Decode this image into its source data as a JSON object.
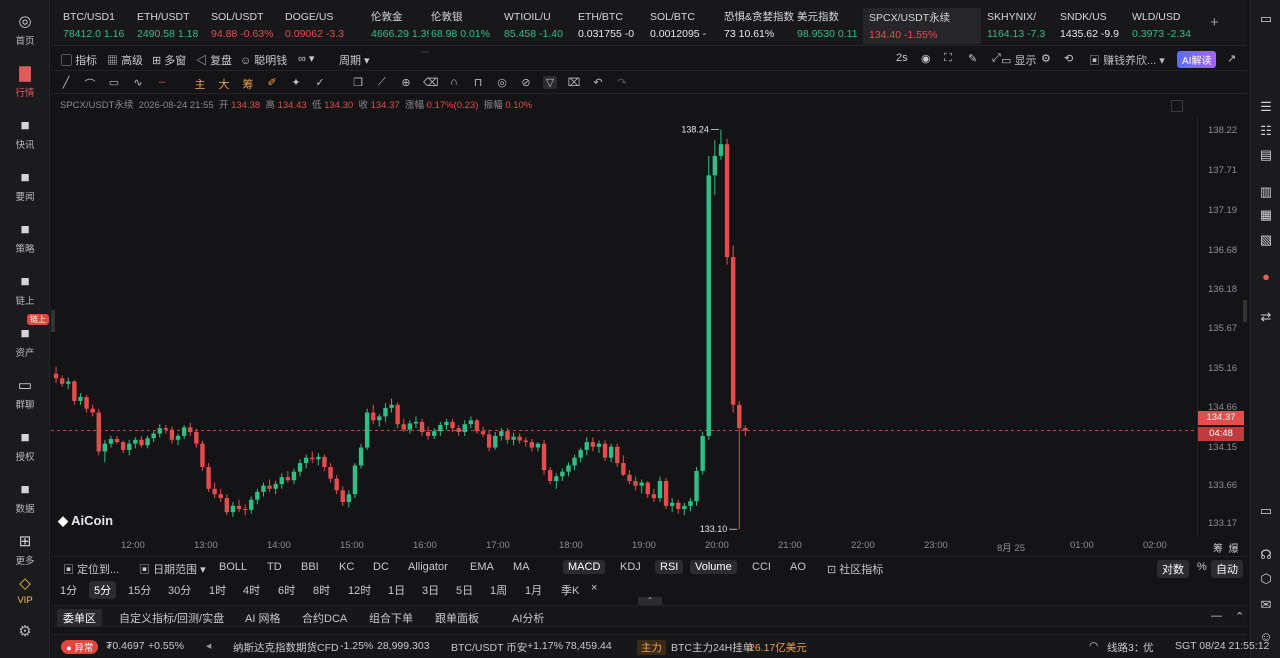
{
  "nav": {
    "items": [
      {
        "label": "首页",
        "icon": "home-icon"
      },
      {
        "label": "行情",
        "icon": "chart-icon"
      },
      {
        "label": "快讯",
        "icon": "news-icon"
      },
      {
        "label": "要闻",
        "icon": "document-icon"
      },
      {
        "label": "策略",
        "icon": "robot-icon"
      },
      {
        "label": "链上",
        "icon": "chain-icon"
      },
      {
        "label": "资产",
        "icon": "wallet-icon"
      },
      {
        "label": "群聊",
        "icon": "chat-icon"
      },
      {
        "label": "授权",
        "icon": "key-icon"
      },
      {
        "label": "数据",
        "icon": "data-icon"
      },
      {
        "label": "更多",
        "icon": "grid-icon"
      },
      {
        "label": "VIP",
        "icon": "diamond-icon"
      }
    ],
    "badge": "链上",
    "settings_icon": "gear-icon"
  },
  "ticker": [
    {
      "name": "BTC/USD1",
      "price": "78412.0",
      "change": "1.16",
      "dir": "up",
      "color": "#f5a623"
    },
    {
      "name": "ETH/USDT",
      "price": "2490.58",
      "change": "1.18",
      "dir": "up",
      "color": "#8a8fa8"
    },
    {
      "name": "SOL/USDT",
      "price": "94.88",
      "change": "-0.63%",
      "dir": "dn",
      "color": "#9d6bff"
    },
    {
      "name": "DOGE/US",
      "price": "0.09062",
      "change": "-3.3",
      "dir": "dn",
      "color": "#c9a94a"
    },
    {
      "name": "伦敦金",
      "price": "4666.29",
      "change": "1.39",
      "dir": "up",
      "color": ""
    },
    {
      "name": "伦敦银",
      "price": "68.98",
      "change": "0.01%",
      "dir": "up",
      "color": ""
    },
    {
      "name": "WTIOIL/U",
      "price": "85.458",
      "change": "-1.40",
      "dir": "up",
      "color": "#5a5a5e"
    },
    {
      "name": "ETH/BTC",
      "price": "0.031755",
      "change": "-0",
      "dir": "none",
      "color": "#8a8fa8"
    },
    {
      "name": "SOL/BTC",
      "price": "0.0012095",
      "change": "-",
      "dir": "none",
      "color": "#9d6bff"
    },
    {
      "name": "恐惧&贪婪指数",
      "price": "73",
      "change": "10.61%",
      "dir": "none",
      "color": ""
    },
    {
      "name": "美元指数",
      "price": "98.9530",
      "change": "0.11",
      "dir": "up",
      "color": ""
    },
    {
      "name": "SPCX/USDT永续",
      "price": "134.40",
      "change": "-1.55%",
      "dir": "dn",
      "color": "#f0c989"
    },
    {
      "name": "SKHYNIX/",
      "price": "1164.13",
      "change": "-7.3",
      "dir": "up",
      "color": "#5a5a5e"
    },
    {
      "name": "SNDK/US",
      "price": "1435.62",
      "change": "-9.9",
      "dir": "none",
      "color": "#5a5a5e"
    },
    {
      "name": "WLD/USD",
      "price": "0.3973",
      "change": "-2.34",
      "dir": "up",
      "color": "#7a7a7e"
    }
  ],
  "toolbar": {
    "indicators": "指标",
    "advanced": "高级",
    "multi": "多窗",
    "replay": "复盘",
    "smart": "聪明钱",
    "period": "周期",
    "intervals": [
      "1分",
      "5分",
      "15分",
      "30分",
      "1时",
      "4时",
      "6时",
      "8时",
      "12时",
      "1日",
      "3日",
      "5日",
      "1周",
      "1月"
    ],
    "selected_interval": "5分",
    "refresh": "2s",
    "display": "显示",
    "strategy": "赚钱养欣...",
    "ai": "AI解读"
  },
  "draw_tools": [
    "主",
    "大",
    "筹"
  ],
  "info": {
    "symbol": "SPCX/USDT永续",
    "datetime": "2026-08-24 21:55",
    "open_label": "开",
    "open": "134.38",
    "high_label": "高",
    "high": "134.43",
    "low_label": "低",
    "low": "134.30",
    "close_label": "收",
    "close": "134.37",
    "chg_label": "涨幅",
    "chg": "0.17%(0.23)",
    "amp_label": "振幅",
    "amp": "0.10%"
  },
  "chart_data": {
    "type": "candlestick",
    "symbol": "SPCX/USDT永续",
    "interval": "5分",
    "y_ticks": [
      138.22,
      137.71,
      137.19,
      136.68,
      136.18,
      135.67,
      135.16,
      134.66,
      134.15,
      133.66,
      133.17
    ],
    "ylim": [
      133.0,
      138.4
    ],
    "x_ticks": [
      "12:00",
      "13:00",
      "14:00",
      "15:00",
      "16:00",
      "17:00",
      "18:00",
      "19:00",
      "20:00",
      "21:00",
      "22:00",
      "23:00",
      "8月 25",
      "01:00",
      "02:00"
    ],
    "current_price": "134.37",
    "countdown": "04:48",
    "high_marker": "138.24",
    "low_marker": "133.10",
    "candles": [
      [
        135.1,
        135.19,
        134.98,
        135.04
      ],
      [
        135.04,
        135.08,
        134.93,
        134.97
      ],
      [
        134.97,
        135.05,
        134.9,
        135.0
      ],
      [
        135.0,
        135.02,
        134.7,
        134.75
      ],
      [
        134.75,
        134.85,
        134.7,
        134.8
      ],
      [
        134.8,
        134.83,
        134.6,
        134.65
      ],
      [
        134.65,
        134.7,
        134.55,
        134.6
      ],
      [
        134.6,
        134.65,
        134.05,
        134.1
      ],
      [
        134.1,
        134.25,
        133.96,
        134.2
      ],
      [
        134.2,
        134.3,
        134.15,
        134.26
      ],
      [
        134.26,
        134.3,
        134.2,
        134.22
      ],
      [
        134.22,
        134.24,
        134.08,
        134.12
      ],
      [
        134.12,
        134.25,
        134.05,
        134.2
      ],
      [
        134.2,
        134.28,
        134.14,
        134.25
      ],
      [
        134.25,
        134.3,
        134.15,
        134.18
      ],
      [
        134.18,
        134.3,
        134.14,
        134.27
      ],
      [
        134.27,
        134.36,
        134.22,
        134.33
      ],
      [
        134.33,
        134.45,
        134.28,
        134.4
      ],
      [
        134.4,
        134.44,
        134.33,
        134.38
      ],
      [
        134.38,
        134.42,
        134.2,
        134.25
      ],
      [
        134.25,
        134.33,
        134.18,
        134.3
      ],
      [
        134.3,
        134.44,
        134.26,
        134.41
      ],
      [
        134.41,
        134.47,
        134.3,
        134.35
      ],
      [
        134.35,
        134.39,
        134.15,
        134.2
      ],
      [
        134.2,
        134.24,
        133.85,
        133.9
      ],
      [
        133.9,
        133.95,
        133.58,
        133.62
      ],
      [
        133.62,
        133.7,
        133.5,
        133.55
      ],
      [
        133.55,
        133.62,
        133.45,
        133.5
      ],
      [
        133.5,
        133.55,
        133.28,
        133.32
      ],
      [
        133.32,
        133.45,
        133.26,
        133.4
      ],
      [
        133.4,
        133.48,
        133.32,
        133.36
      ],
      [
        133.36,
        133.42,
        133.28,
        133.35
      ],
      [
        133.35,
        133.52,
        133.3,
        133.48
      ],
      [
        133.48,
        133.62,
        133.42,
        133.58
      ],
      [
        133.58,
        133.7,
        133.52,
        133.66
      ],
      [
        133.66,
        133.74,
        133.58,
        133.62
      ],
      [
        133.62,
        133.72,
        133.55,
        133.68
      ],
      [
        133.68,
        133.82,
        133.62,
        133.77
      ],
      [
        133.77,
        133.85,
        133.7,
        133.73
      ],
      [
        133.73,
        133.88,
        133.68,
        133.84
      ],
      [
        133.84,
        134.0,
        133.78,
        133.95
      ],
      [
        133.95,
        134.06,
        133.88,
        134.02
      ],
      [
        134.02,
        134.1,
        133.95,
        134.0
      ],
      [
        134.0,
        134.08,
        133.92,
        134.03
      ],
      [
        134.03,
        134.06,
        133.85,
        133.9
      ],
      [
        133.9,
        133.95,
        133.7,
        133.75
      ],
      [
        133.75,
        133.8,
        133.55,
        133.6
      ],
      [
        133.6,
        133.65,
        133.4,
        133.45
      ],
      [
        133.45,
        133.6,
        133.38,
        133.55
      ],
      [
        133.55,
        133.95,
        133.5,
        133.92
      ],
      [
        133.92,
        134.2,
        133.88,
        134.15
      ],
      [
        134.15,
        134.65,
        134.12,
        134.6
      ],
      [
        134.6,
        134.7,
        134.45,
        134.5
      ],
      [
        134.5,
        134.58,
        134.42,
        134.55
      ],
      [
        134.55,
        134.72,
        134.48,
        134.66
      ],
      [
        134.66,
        134.78,
        134.6,
        134.7
      ],
      [
        134.7,
        134.73,
        134.4,
        134.45
      ],
      [
        134.45,
        134.52,
        134.35,
        134.38
      ],
      [
        134.38,
        134.5,
        134.33,
        134.46
      ],
      [
        134.46,
        134.55,
        134.4,
        134.48
      ],
      [
        134.48,
        134.52,
        134.3,
        134.35
      ],
      [
        134.35,
        134.42,
        134.25,
        134.3
      ],
      [
        134.3,
        134.4,
        134.26,
        134.36
      ],
      [
        134.36,
        134.48,
        134.3,
        134.44
      ],
      [
        134.44,
        134.52,
        134.38,
        134.48
      ],
      [
        134.48,
        134.52,
        134.35,
        134.4
      ],
      [
        134.4,
        134.44,
        134.3,
        134.35
      ],
      [
        134.35,
        134.5,
        134.3,
        134.45
      ],
      [
        134.45,
        134.55,
        134.4,
        134.5
      ],
      [
        134.5,
        134.52,
        134.33,
        134.36
      ],
      [
        134.36,
        134.42,
        134.28,
        134.32
      ],
      [
        134.32,
        134.38,
        134.1,
        134.15
      ],
      [
        134.15,
        134.35,
        134.12,
        134.3
      ],
      [
        134.3,
        134.4,
        134.24,
        134.36
      ],
      [
        134.36,
        134.4,
        134.2,
        134.25
      ],
      [
        134.25,
        134.34,
        134.18,
        134.29
      ],
      [
        134.29,
        134.33,
        134.2,
        134.24
      ],
      [
        134.24,
        134.28,
        134.16,
        134.22
      ],
      [
        134.22,
        134.26,
        134.1,
        134.15
      ],
      [
        134.15,
        134.22,
        134.1,
        134.2
      ],
      [
        134.2,
        134.25,
        133.8,
        133.86
      ],
      [
        133.86,
        133.9,
        133.68,
        133.72
      ],
      [
        133.72,
        133.82,
        133.62,
        133.78
      ],
      [
        133.78,
        133.88,
        133.72,
        133.84
      ],
      [
        133.84,
        133.96,
        133.78,
        133.92
      ],
      [
        133.92,
        134.06,
        133.86,
        134.02
      ],
      [
        134.02,
        134.15,
        133.96,
        134.12
      ],
      [
        134.12,
        134.28,
        134.05,
        134.22
      ],
      [
        134.22,
        134.28,
        134.1,
        134.16
      ],
      [
        134.16,
        134.24,
        134.08,
        134.2
      ],
      [
        134.2,
        134.24,
        133.98,
        134.02
      ],
      [
        134.02,
        134.2,
        133.96,
        134.16
      ],
      [
        134.16,
        134.2,
        133.9,
        133.95
      ],
      [
        133.95,
        134.05,
        133.78,
        133.8
      ],
      [
        133.8,
        133.86,
        133.68,
        133.72
      ],
      [
        133.72,
        133.78,
        133.6,
        133.66
      ],
      [
        133.66,
        133.74,
        133.56,
        133.7
      ],
      [
        133.7,
        133.72,
        133.5,
        133.55
      ],
      [
        133.55,
        133.62,
        133.45,
        133.5
      ],
      [
        133.5,
        133.78,
        133.45,
        133.72
      ],
      [
        133.72,
        133.76,
        133.36,
        133.4
      ],
      [
        133.4,
        133.5,
        133.32,
        133.44
      ],
      [
        133.44,
        133.48,
        133.3,
        133.36
      ],
      [
        133.36,
        133.44,
        133.28,
        133.4
      ],
      [
        133.4,
        133.5,
        133.33,
        133.46
      ],
      [
        133.46,
        133.9,
        133.4,
        133.85
      ],
      [
        133.85,
        134.35,
        133.8,
        134.3
      ],
      [
        134.3,
        137.9,
        134.25,
        137.65
      ],
      [
        137.65,
        138.1,
        137.4,
        137.9
      ],
      [
        137.9,
        138.24,
        137.85,
        138.05
      ],
      [
        138.05,
        138.12,
        136.5,
        136.6
      ],
      [
        136.6,
        136.75,
        134.6,
        134.7
      ],
      [
        134.7,
        134.75,
        133.1,
        134.4
      ],
      [
        134.4,
        134.43,
        134.3,
        134.37
      ]
    ]
  },
  "indicators": {
    "position": "定位到...",
    "daterange": "日期范围",
    "overlays": [
      "BOLL",
      "TD",
      "BBI",
      "KC",
      "DC",
      "Alligator",
      "EMA",
      "MA"
    ],
    "subs": [
      "MACD",
      "KDJ",
      "RSI",
      "Volume",
      "CCI",
      "AO"
    ],
    "subs_on": [
      "MACD",
      "RSI",
      "Volume"
    ],
    "community": "社区指标",
    "log": "对数",
    "pct": "%",
    "auto": "自动"
  },
  "periods": {
    "items": [
      "1分",
      "5分",
      "15分",
      "30分",
      "1时",
      "4时",
      "6时",
      "8时",
      "12时",
      "1日",
      "3日",
      "5日",
      "1周",
      "1月",
      "季K"
    ],
    "selected": "5分",
    "close": "×"
  },
  "tabs": {
    "items": [
      "委单区",
      "自定义指标/回测/实盘",
      "AI 网格",
      "合约DCA",
      "组合下单",
      "跟单面板",
      "AI分析"
    ],
    "selected": "委单区"
  },
  "status": {
    "alert": "异常",
    "price": "₮0.4697",
    "pct": "+0.55%",
    "nasdaq": "纳斯达克指数期货CFD",
    "nasdaq_pct": "-1.25%",
    "nasdaq_val": "28,999.303",
    "btc": "BTC/USDT 币安",
    "btc_pct": "+1.17%",
    "btc_val": "78,459.44",
    "main_tag": "主力",
    "main_text": "BTC主力24H挂单",
    "main_val": "26.17亿美元",
    "line": "线路3：",
    "line_q": "优",
    "time": "SGT 08/24 21:55:12"
  },
  "logo": "AiCoin",
  "colors": {
    "up": "#2fbf86",
    "down": "#e34d4d",
    "accent": "#e25c5c"
  }
}
